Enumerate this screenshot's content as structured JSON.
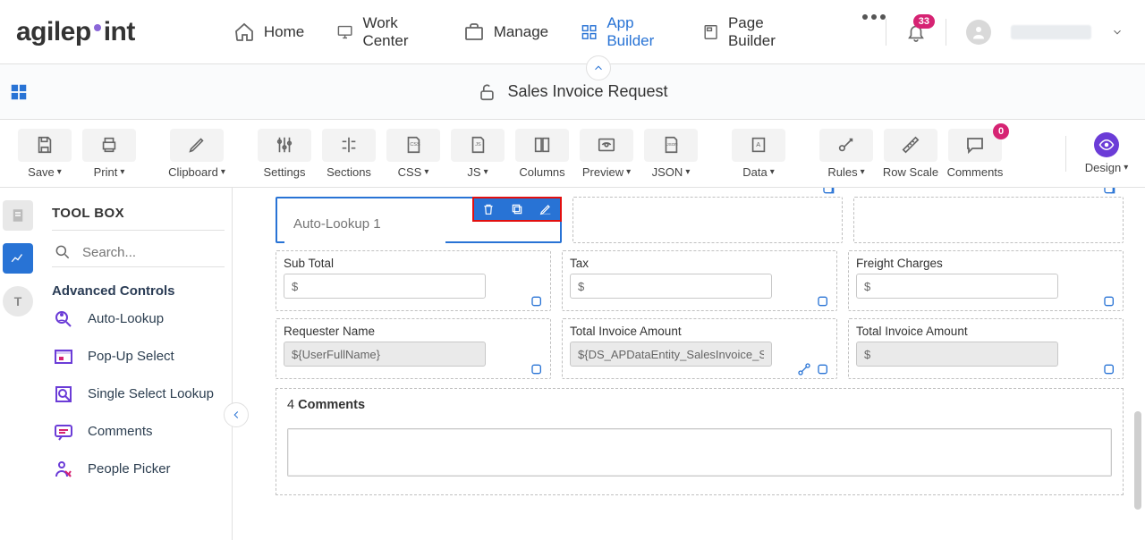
{
  "nav": {
    "items": [
      {
        "label": "Home"
      },
      {
        "label": "Work Center"
      },
      {
        "label": "Manage"
      },
      {
        "label": "App Builder"
      },
      {
        "label": "Page Builder"
      }
    ],
    "notification_count": "33"
  },
  "doc": {
    "title": "Sales Invoice Request"
  },
  "toolbar": {
    "save": "Save",
    "print": "Print",
    "clipboard": "Clipboard",
    "settings": "Settings",
    "sections": "Sections",
    "css": "CSS",
    "js": "JS",
    "columns": "Columns",
    "preview": "Preview",
    "json": "JSON",
    "data": "Data",
    "rules": "Rules",
    "rowscale": "Row Scale",
    "comments": "Comments",
    "comments_count": "0",
    "design": "Design"
  },
  "sidebar": {
    "title": "TOOL BOX",
    "search_placeholder": "Search...",
    "section": "Advanced Controls",
    "items": [
      {
        "label": "Auto-Lookup"
      },
      {
        "label": "Pop-Up Select"
      },
      {
        "label": "Single Select Lookup"
      },
      {
        "label": "Comments"
      },
      {
        "label": "People Picker"
      }
    ]
  },
  "canvas": {
    "selected_placeholder": "Auto-Lookup 1",
    "row2": [
      {
        "label": "Sub Total",
        "value": "$"
      },
      {
        "label": "Tax",
        "value": "$"
      },
      {
        "label": "Freight Charges",
        "value": "$"
      }
    ],
    "row3": [
      {
        "label": "Requester Name",
        "value": "${UserFullName}",
        "gray": true
      },
      {
        "label": "Total Invoice Amount",
        "value": "${DS_APDataEntity_SalesInvoice_Sub",
        "gray": true
      },
      {
        "label": "Total Invoice Amount",
        "value": "$",
        "gray": true
      }
    ],
    "comments_count": "4",
    "comments_word": "Comments"
  }
}
